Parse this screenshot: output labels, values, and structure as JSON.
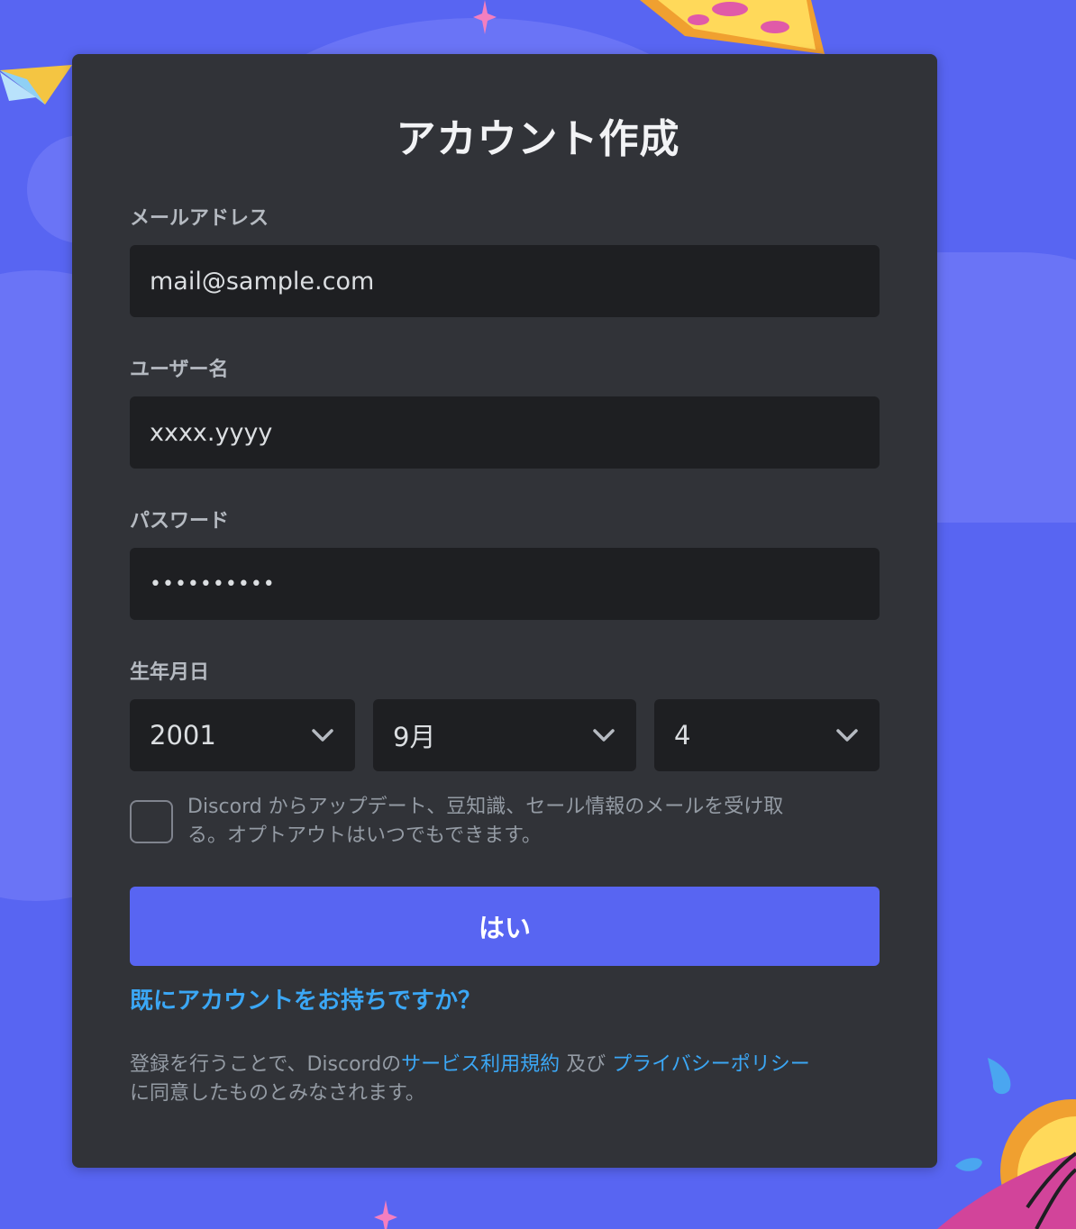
{
  "form": {
    "title": "アカウント作成",
    "email": {
      "label": "メールアドレス",
      "value": "mail@sample.com"
    },
    "username": {
      "label": "ユーザー名",
      "value": "xxxx.yyyy"
    },
    "password": {
      "label": "パスワード",
      "value": "••••••••••"
    },
    "birthdate": {
      "label": "生年月日",
      "year": "2001",
      "month": "9月",
      "day": "4"
    },
    "newsletter": {
      "checked": false,
      "line1": "Discord からアップデート、豆知識、セール情報のメールを受け取",
      "line2": "る。オプトアウトはいつでもできます。"
    },
    "submit_label": "はい",
    "login_link": "既にアカウントをお持ちですか？",
    "terms": {
      "prefix": "登録を行うことで、Discordの",
      "tos_link": "サービス利用規約",
      "middle": " 及び ",
      "privacy_link": "プライバシーポリシー",
      "suffix": "に同意したものとみなされます。"
    }
  },
  "colors": {
    "background": "#5865f2",
    "card": "#313338",
    "input": "#1e1f22",
    "accent": "#5865f2",
    "link": "#3ba7f5"
  }
}
